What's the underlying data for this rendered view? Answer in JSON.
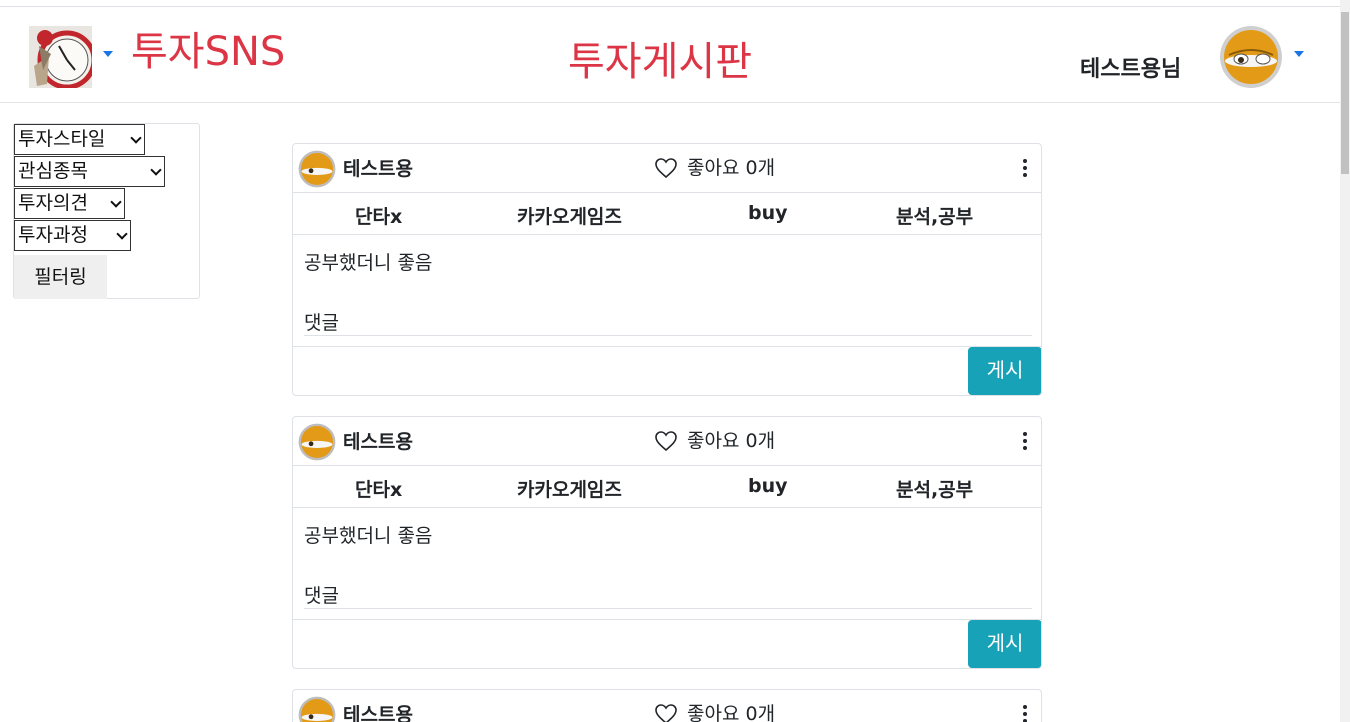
{
  "header": {
    "brand": "투자SNS",
    "page_title": "투자게시판",
    "user_name": "테스트용님",
    "accent_color": "#dc3545"
  },
  "filters": {
    "style": "투자스타일",
    "interest": "관심종목",
    "opinion": "투자의견",
    "process": "투자과정",
    "button": "필터링"
  },
  "posts": [
    {
      "author": "테스트용",
      "likes": "좋아요 0개",
      "tags": [
        "단타x",
        "카카오게임즈",
        "buy",
        "분석,공부"
      ],
      "body": "공부했더니 좋음",
      "comment_label": "댓글",
      "submit": "게시"
    },
    {
      "author": "테스트용",
      "likes": "좋아요 0개",
      "tags": [
        "단타x",
        "카카오게임즈",
        "buy",
        "분석,공부"
      ],
      "body": "공부했더니 좋음",
      "comment_label": "댓글",
      "submit": "게시"
    },
    {
      "author": "테스트용",
      "likes": "좋아요 0개"
    }
  ],
  "icons": {
    "heart": "heart-outline-icon",
    "menu": "kebab-menu-icon",
    "dropdown": "caret-down-icon"
  },
  "colors": {
    "button": "#17a2b8",
    "caret": "#1a73e8"
  }
}
